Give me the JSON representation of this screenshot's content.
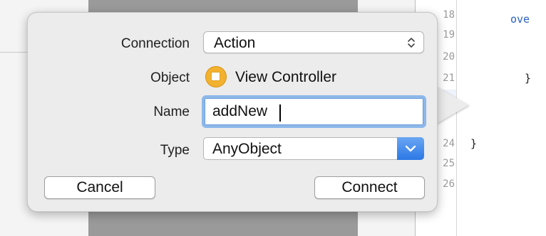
{
  "editor": {
    "line_numbers": [
      "18",
      "19",
      "20",
      "21",
      "24",
      "25",
      "26"
    ],
    "code_keyword": "ove",
    "brace_inner": "}",
    "brace_outer": "}"
  },
  "form": {
    "connection": {
      "label": "Connection",
      "value": "Action"
    },
    "object": {
      "label": "Object",
      "value": "View Controller"
    },
    "name": {
      "label": "Name",
      "value": "addNew"
    },
    "type": {
      "label": "Type",
      "value": "AnyObject"
    }
  },
  "buttons": {
    "cancel": "Cancel",
    "connect": "Connect"
  },
  "colors": {
    "object_icon": "#f2b230",
    "focus_ring": "#8db8ea",
    "dropdown_accent": "#2c78e6",
    "keyword": "#2a62c8"
  },
  "icons": {
    "connection_select": "up-down-chevron-icon",
    "type_select": "chevron-down-icon",
    "object": "view-controller-icon"
  }
}
